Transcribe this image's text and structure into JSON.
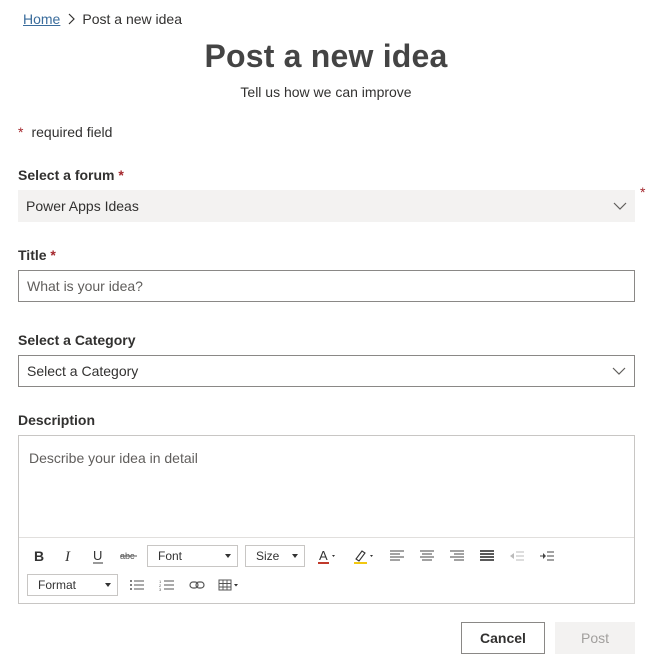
{
  "breadcrumb": {
    "home": "Home",
    "current": "Post a new idea"
  },
  "header": {
    "title": "Post a new idea",
    "subtitle": "Tell us how we can improve"
  },
  "required_note": {
    "star": "*",
    "text": "required field"
  },
  "form": {
    "forum": {
      "label": "Select a forum",
      "required_mark": "*",
      "value": "Power Apps Ideas",
      "outer_mark": "*"
    },
    "title": {
      "label": "Title",
      "required_mark": "*",
      "placeholder": "What is your idea?"
    },
    "category": {
      "label": "Select a Category",
      "value": "Select a Category"
    },
    "description": {
      "label": "Description",
      "placeholder": "Describe your idea in detail",
      "toolbar": {
        "font": "Font",
        "size": "Size",
        "format": "Format",
        "icons": [
          "bold-icon",
          "italic-icon",
          "underline-icon",
          "strikethrough-icon",
          "font-color-icon",
          "highlight-icon",
          "align-left-icon",
          "align-center-icon",
          "align-right-icon",
          "justify-icon",
          "outdent-icon",
          "indent-icon",
          "bulleted-list-icon",
          "numbered-list-icon",
          "link-icon",
          "table-icon"
        ]
      }
    }
  },
  "actions": {
    "cancel": "Cancel",
    "post": "Post"
  },
  "colors": {
    "required": "#a4262c",
    "link": "#3a6c9c",
    "font_color_bar": "#c0392b",
    "highlight_bar": "#f2c811"
  }
}
